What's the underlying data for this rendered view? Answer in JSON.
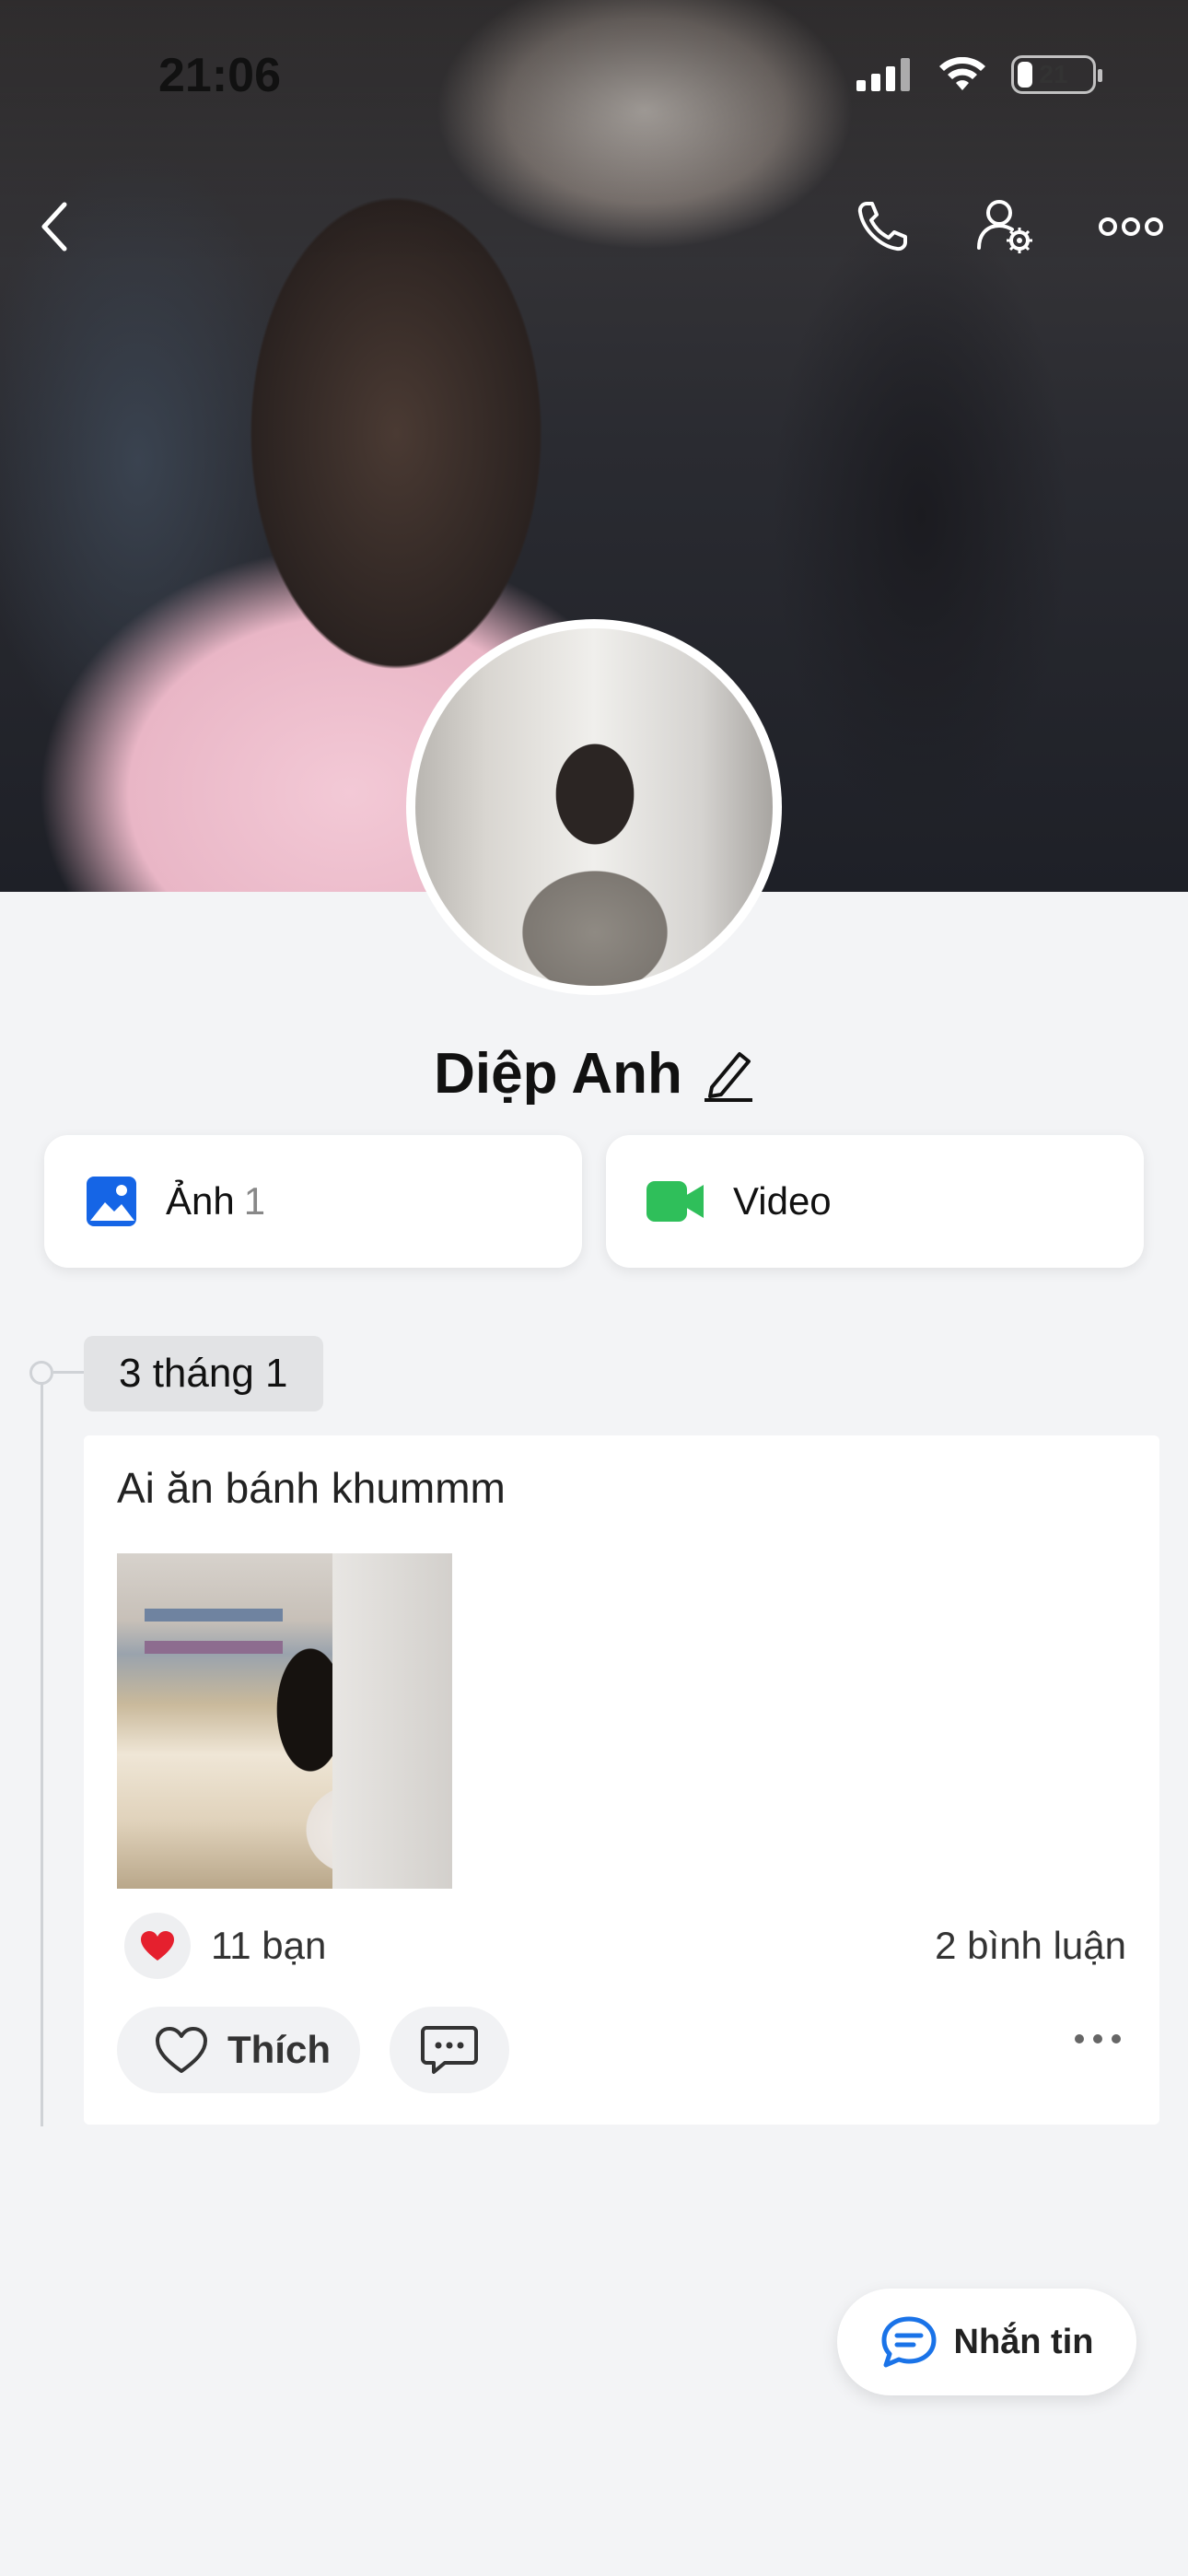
{
  "status_bar": {
    "time": "21:06",
    "battery_level": "21"
  },
  "header": {
    "back_icon": "chevron-left-icon",
    "call_icon": "phone-icon",
    "settings_icon": "user-settings-icon",
    "more_icon": "more-horizontal-icon"
  },
  "profile": {
    "name": "Diệp Anh",
    "edit_icon": "pencil-icon"
  },
  "media": {
    "photos_label": "Ảnh",
    "photos_count": "1",
    "video_label": "Video",
    "photo_icon_color": "#1565e6",
    "video_icon_color": "#2fbf5a"
  },
  "timeline": {
    "date": "3 tháng 1",
    "post": {
      "text": "Ai ăn bánh khummm",
      "reactions_text": "11 bạn",
      "comments_text": "2 bình luận",
      "like_label": "Thích",
      "heart_color": "#e5202e"
    }
  },
  "fab": {
    "label": "Nhắn tin",
    "icon_color": "#1a73e8"
  }
}
